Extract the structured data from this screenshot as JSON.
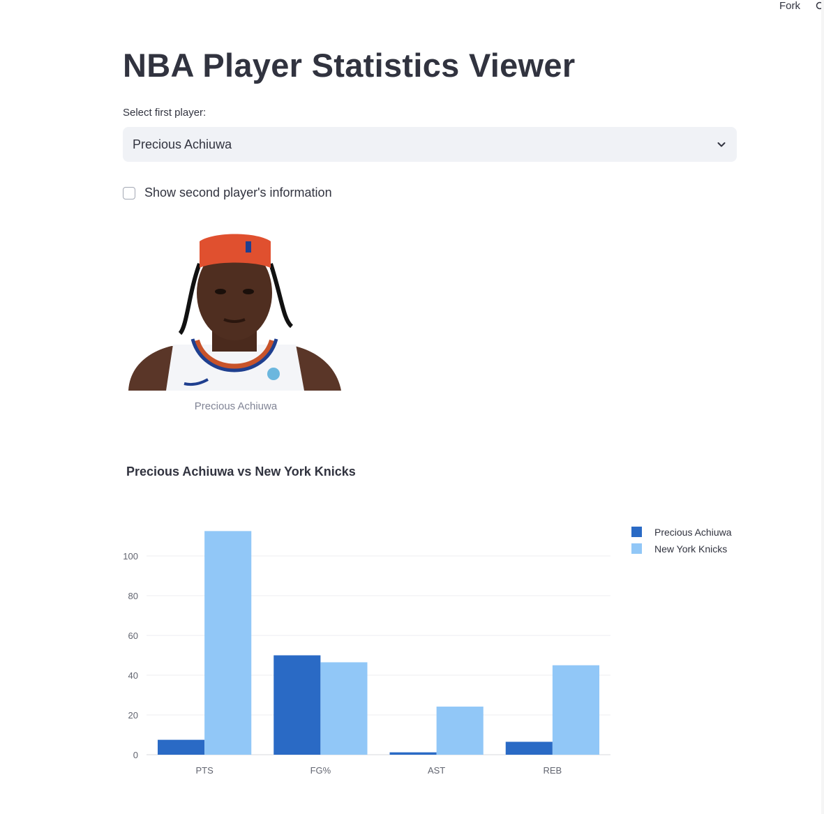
{
  "toolbar": {
    "fork_label": "Fork",
    "github_icon": "github-icon"
  },
  "app": {
    "title": "NBA Player Statistics Viewer",
    "select_label": "Select first player:",
    "selected_player": "Precious Achiuwa",
    "checkbox_label": "Show second player's information",
    "checkbox_checked": false,
    "photo_caption": "Precious Achiuwa"
  },
  "chart_data": {
    "type": "bar",
    "title": "Precious Achiuwa vs New York Knicks",
    "categories": [
      "PTS",
      "FG%",
      "AST",
      "REB"
    ],
    "series": [
      {
        "name": "Precious Achiuwa",
        "values": [
          7.5,
          50,
          1.2,
          6.5
        ],
        "color": "#2a6ac5"
      },
      {
        "name": "New York Knicks",
        "values": [
          112.5,
          46.5,
          24.2,
          45
        ],
        "color": "#91c7f7"
      }
    ],
    "ylim": [
      0,
      113
    ],
    "yticks": [
      0,
      20,
      40,
      60,
      80,
      100
    ],
    "xlabel": "",
    "ylabel": "",
    "grid": true,
    "legend": "top-right"
  }
}
